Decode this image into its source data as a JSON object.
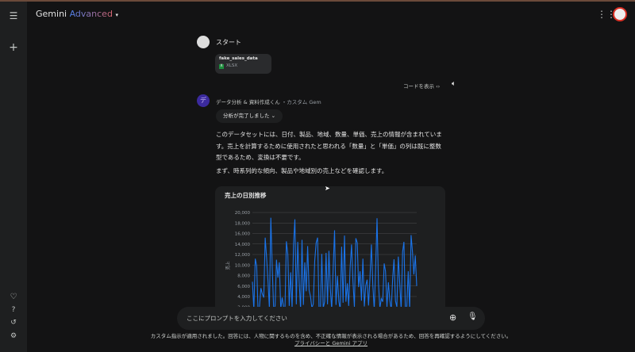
{
  "header": {
    "brand": "Gemini",
    "tier": "Advanced",
    "dropdown_icon": "caret-down-icon"
  },
  "user": {
    "message": "スタート",
    "file": {
      "name": "fake_sales_data",
      "type": "XLSX"
    }
  },
  "response": {
    "show_code": "コードを表示",
    "gem_initial": "デ",
    "gem_name": "データ分析 & 資料作成くん",
    "gem_sub": "・カスタム Gem",
    "status": "分析が完了しました",
    "paragraphs": [
      "このデータセットには、日付、製品、地域、数量、単価、売上の情報が含まれています。売上を計算するために使用されたと思われる「数量」と「単価」の列は既に整数型であるため、変換は不要です。",
      "まず、時系列的な傾向、製品や地域別の売上などを確認します。"
    ]
  },
  "input": {
    "placeholder": "ここにプロンプトを入力してください"
  },
  "disclaimer": {
    "text": "カスタム指示が適用されました。回答には、人物に関するものを含め、不正確な情報が表示される場合があるため、回答を再確認するようにしてください。",
    "link": "プライバシーと Gemini アプリ"
  },
  "colors": {
    "line": "#1a73e8",
    "background": "#131314"
  },
  "chart_data": {
    "type": "line",
    "title": "売上の日別推移",
    "ylabel": "売上",
    "ylim": [
      0,
      20000
    ],
    "grid": true,
    "yticks": [
      "2,000",
      "4,000",
      "6,000",
      "8,000",
      "10,000",
      "12,000",
      "14,000",
      "16,000",
      "18,000",
      "20,000"
    ],
    "values": [
      6800,
      1500,
      11200,
      9800,
      1200,
      2000,
      5600,
      4500,
      3800,
      15200,
      11600,
      7000,
      1800,
      19000,
      9400,
      1500,
      2200,
      11000,
      7600,
      10500,
      1600,
      3800,
      2000,
      1500,
      14500,
      12000,
      2200,
      8600,
      1800,
      13800,
      18700,
      2500,
      14400,
      6800,
      1500,
      14800,
      2400,
      10500,
      5000,
      13600,
      5200,
      4000,
      1800,
      2600,
      10800,
      14200,
      15200,
      2000,
      1500,
      12100,
      1800,
      3000,
      12300,
      2500,
      12700,
      5600,
      1500,
      9200,
      16600,
      2400,
      7900,
      3100,
      1500,
      13500,
      2800,
      15600,
      3000,
      6500,
      2200,
      9500,
      13900,
      6800,
      2000,
      15100,
      14200,
      5800,
      8800,
      3200,
      11200,
      2100,
      6100,
      7200,
      2300,
      7500,
      13900,
      6200,
      1500,
      9600,
      18900,
      6500,
      1800,
      3600,
      3000,
      10300,
      8800,
      2000,
      6700,
      3300,
      1400,
      7500,
      11100,
      3200,
      2000,
      11600,
      6500,
      1500,
      12500,
      14400,
      1500,
      2100,
      8800,
      1500,
      15700,
      12600,
      8200,
      11800,
      6000
    ]
  }
}
